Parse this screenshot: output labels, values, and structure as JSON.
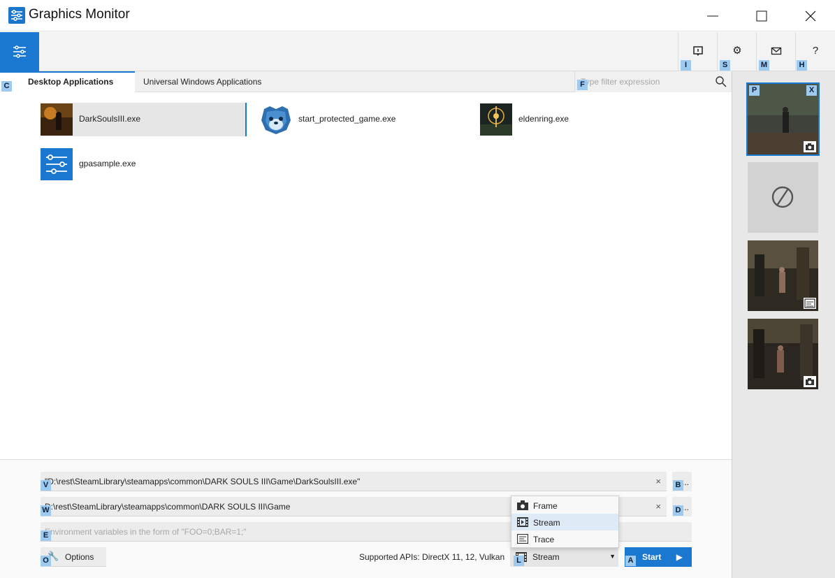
{
  "window": {
    "title": "Graphics Monitor"
  },
  "toolbar": {
    "hotkeys": {
      "info": "I",
      "settings": "S",
      "mail": "M",
      "help": "H",
      "help_glyph": "?"
    }
  },
  "tabs": [
    {
      "label": "Desktop Applications",
      "hotkey": "C"
    },
    {
      "label": "Universal Windows Applications"
    }
  ],
  "filter": {
    "placeholder": "Type filter expression",
    "hotkey": "F"
  },
  "apps": [
    {
      "name": "DarkSoulsIII.exe",
      "icon": "darksouls-thumbnail"
    },
    {
      "name": "start_protected_game.exe",
      "icon": "eac-bear-icon"
    },
    {
      "name": "eldenring.exe",
      "icon": "eldenring-thumbnail"
    },
    {
      "name": "gpasample.exe",
      "icon": "gpa-sliders-icon"
    }
  ],
  "captures": {
    "hotkey_prev": "P",
    "hotkey_close": "X"
  },
  "bottom": {
    "exe_path": "\"D:\\rest\\SteamLibrary\\steamapps\\common\\DARK SOULS III\\Game\\DarkSoulsIII.exe\"",
    "exe_hotkey": "V",
    "browse_exe_hotkey": "B",
    "workdir": "D:\\rest\\SteamLibrary\\steamapps\\common\\DARK SOULS III\\Game",
    "workdir_hotkey": "W",
    "browse_dir_hotkey": "D",
    "env_placeholder": "Environment variables in the form of \"FOO=0;BAR=1;\"",
    "env_hotkey": "E",
    "browse_dots": "...",
    "clear_glyph": "×",
    "options_label": "Options",
    "options_hotkey": "O",
    "supported_apis": "Supported APIs: DirectX 11, 12, Vulkan",
    "mode_value": "Stream",
    "mode_hotkey": "L",
    "start_label": "Start",
    "start_hotkey": "A"
  },
  "mode_options": [
    {
      "label": "Frame",
      "icon": "camera-icon"
    },
    {
      "label": "Stream",
      "icon": "film-icon",
      "highlighted": true
    },
    {
      "label": "Trace",
      "icon": "trace-icon"
    }
  ],
  "colors": {
    "accent": "#1a78d0",
    "hotkey_bg": "#9ecaf0"
  }
}
